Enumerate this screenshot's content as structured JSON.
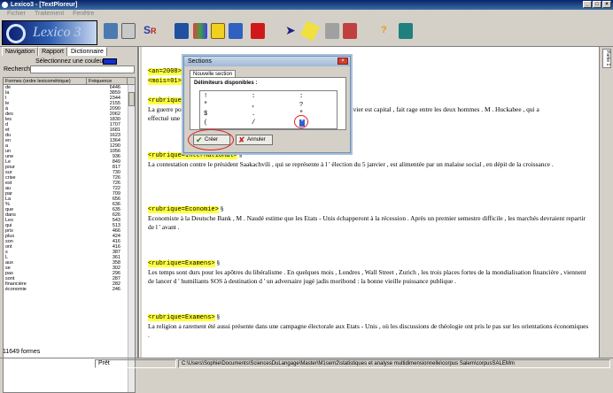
{
  "window": {
    "title": "Lexico3 - [TextPloreur]",
    "controls": [
      "_",
      "□",
      "×"
    ]
  },
  "menu": [
    "Fichier",
    "Traitement",
    "Fenêtre"
  ],
  "toolbar": {
    "logo_text": "Lexico 3",
    "tools": [
      "table-icon",
      "notebook-icon",
      "s-r-icon",
      "pele-icon",
      "chart-icon",
      "grid-icon",
      "cube-icon",
      "play-icon",
      "pencil-icon",
      "wrench-icon",
      "tools-icon",
      "help-icon",
      "exit-icon"
    ]
  },
  "left_panel": {
    "tabs": [
      "Navigation",
      "Rapport",
      "Dictionnaire"
    ],
    "active_tab": "Dictionnaire",
    "color_label": "Sélectionnez une couleur",
    "search_label": "Recherche :",
    "columns": [
      "Formes (ordre lexicométrique)",
      "Fréquence"
    ],
    "rows": [
      [
        "de",
        "6446"
      ],
      [
        "la",
        "3859"
      ],
      [
        "l",
        "2344"
      ],
      [
        "le",
        "2155"
      ],
      [
        "à",
        "2090"
      ],
      [
        "des",
        "2062"
      ],
      [
        "les",
        "1830"
      ],
      [
        "d",
        "1707"
      ],
      [
        "et",
        "1681"
      ],
      [
        "du",
        "1623"
      ],
      [
        "en",
        "1364"
      ],
      [
        "a",
        "1290"
      ],
      [
        "un",
        "1056"
      ],
      [
        "une",
        "936"
      ],
      [
        "Le",
        "849"
      ],
      [
        "pour",
        "817"
      ],
      [
        "sur",
        "730"
      ],
      [
        "crise",
        "726"
      ],
      [
        "est",
        "726"
      ],
      [
        "au",
        "722"
      ],
      [
        "par",
        "709"
      ],
      [
        "La",
        "656"
      ],
      [
        "%",
        "636"
      ],
      [
        "que",
        "635"
      ],
      [
        "dans",
        "626"
      ],
      [
        "Les",
        "543"
      ],
      [
        "qui",
        "513"
      ],
      [
        "prix",
        "466"
      ],
      [
        "plus",
        "424"
      ],
      [
        "son",
        "416"
      ],
      [
        "ont",
        "416"
      ],
      [
        "s",
        "387"
      ],
      [
        "L",
        "361"
      ],
      [
        "aux",
        "358"
      ],
      [
        "se",
        "302"
      ],
      [
        "pas",
        "296"
      ],
      [
        "sont",
        "287"
      ],
      [
        "financière",
        "282"
      ],
      [
        "économie",
        "246"
      ]
    ],
    "count_text": "11649 formes"
  },
  "document": {
    "header_tags": [
      "<an=2008>",
      "<mois=01>"
    ],
    "blocks": [
      {
        "tag": "<rubrique=",
        "text": "La guerre po… du 3 janvier est capital , fait rage entre les deux hommes . M . Huckabee , qui a effectué une",
        "line2": "effectué une"
      },
      {
        "tag": "<rubrique=International>",
        "text": "La contestation contre le président Saakachvili , qui se représente à l ' élection du 5 janvier , est alimentée par un malaise social , en dépit de la croissance ."
      },
      {
        "tag": "<rubrique=Economie>",
        "text": "Economiste à la Deutsche Bank , M . Naudé estime que les Etats - Unis échapperont à la récession . Après un premier semestre difficile , les marchés devraient repartir de l ' avant ."
      },
      {
        "tag": "<rubrique=Examens>",
        "text": "Les temps sont durs pour les apôtres du libéralisme . En quelques mois , Londres , Wall Street , Zurich , les trois places fortes de la mondialisation financière , viennent de lancer d ' humiliants SOS à destination d ' un adversaire jugé jadis moribond : la bonne vieille puissance publique ."
      },
      {
        "tag": "<rubrique=Examens>",
        "text": "La religion a rarement été aussi présente dans une campagne électorale aux Etats - Unis , où les discussions de théologie ont pris le pas sur les orientations économiques ."
      }
    ],
    "section_mark": "§",
    "partial_line1": "La guerre po",
    "partial_line1_tail": "du 3 janvier est capital , fait rage entre les deux hommes . M . Huckabee , qui a",
    "partial_line2": "effectué une"
  },
  "right_bar": {
    "tab_label": "Partie 1"
  },
  "dialog": {
    "title": "Sections",
    "tab": "Nouvelle section",
    "label": "Délimiteurs disponibles :",
    "delimiters": [
      "!",
      ":",
      ":",
      "\"",
      ",",
      "?",
      "$",
      ".",
      "\"",
      "(",
      "/",
      "\""
    ],
    "create_label": "Créer",
    "cancel_label": "Annuler"
  },
  "status": {
    "ready": "Prêt",
    "path": "C:\\Users\\Sophie\\Documents\\SciencesDuLangage\\Master\\M1sem2\\statistiques et analyse multidimensionnelle\\corpus Salem\\corpusSALEMm"
  }
}
